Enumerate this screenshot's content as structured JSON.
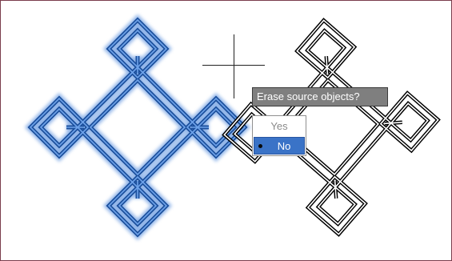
{
  "prompt": {
    "text": "Erase source objects?"
  },
  "options": [
    {
      "label": "Yes",
      "selected": false
    },
    {
      "label": "No",
      "selected": true
    }
  ],
  "colors": {
    "source_object": "#1f5fb4",
    "copied_object": "#000000",
    "highlight": "#3a73c7",
    "prompt_bg": "#7f7f7f"
  },
  "icons": {
    "cursor": "crosshair-cursor-icon",
    "selection": "bullet-icon"
  }
}
